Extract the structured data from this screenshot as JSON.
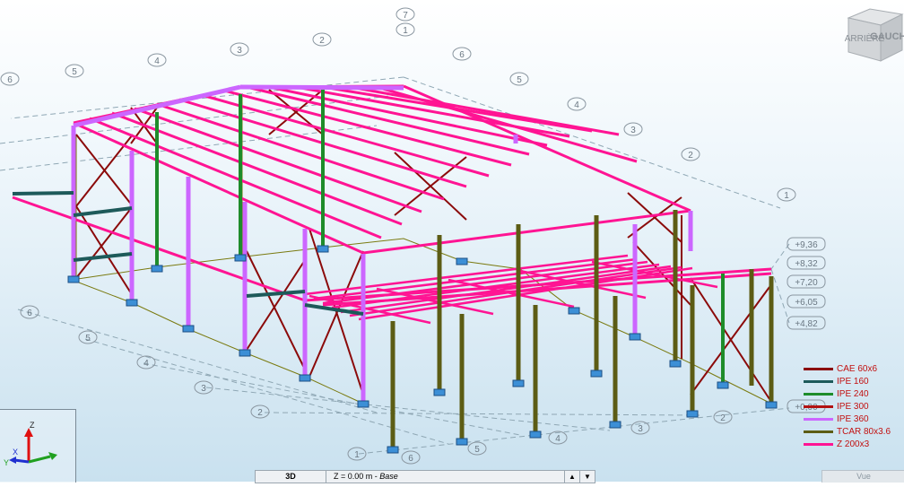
{
  "view": {
    "cube_label": "GAUCHE",
    "cube_back_label": "ARRIÈRE"
  },
  "grid_labels_top": [
    "7",
    "1",
    "2",
    "3",
    "4",
    "5",
    "6"
  ],
  "grid_labels_right": [
    "6",
    "5",
    "4",
    "3",
    "2",
    "1"
  ],
  "grid_labels_left": [
    "6"
  ],
  "grid_labels_front": [
    "6",
    "5",
    "4",
    "3",
    "2",
    "1"
  ],
  "grid_labels_bottom": [
    "6",
    "5",
    "4",
    "3",
    "2"
  ],
  "elevations": [
    "+9,36",
    "+8,32",
    "+7,20",
    "+6,05",
    "+4,82",
    "+0,00"
  ],
  "legend": [
    {
      "label": "CAE 60x6",
      "color": "#8b0a0a"
    },
    {
      "label": "IPE 160",
      "color": "#1d5a5a"
    },
    {
      "label": "IPE 240",
      "color": "#1e8c2a"
    },
    {
      "label": "IPE 300",
      "color": "#b21212"
    },
    {
      "label": "IPE 360",
      "color": "#cc66ff"
    },
    {
      "label": "TCAR 80x3.6",
      "color": "#5c5c14"
    },
    {
      "label": "Z 200x3",
      "color": "#ff1493"
    }
  ],
  "axes": {
    "x": "X",
    "y": "Y",
    "z": "Z"
  },
  "statusbar": {
    "view": "3D",
    "level_prefix": "Z = 0.00 m - ",
    "level_name": "Base"
  },
  "bottom_tab": "Vue"
}
